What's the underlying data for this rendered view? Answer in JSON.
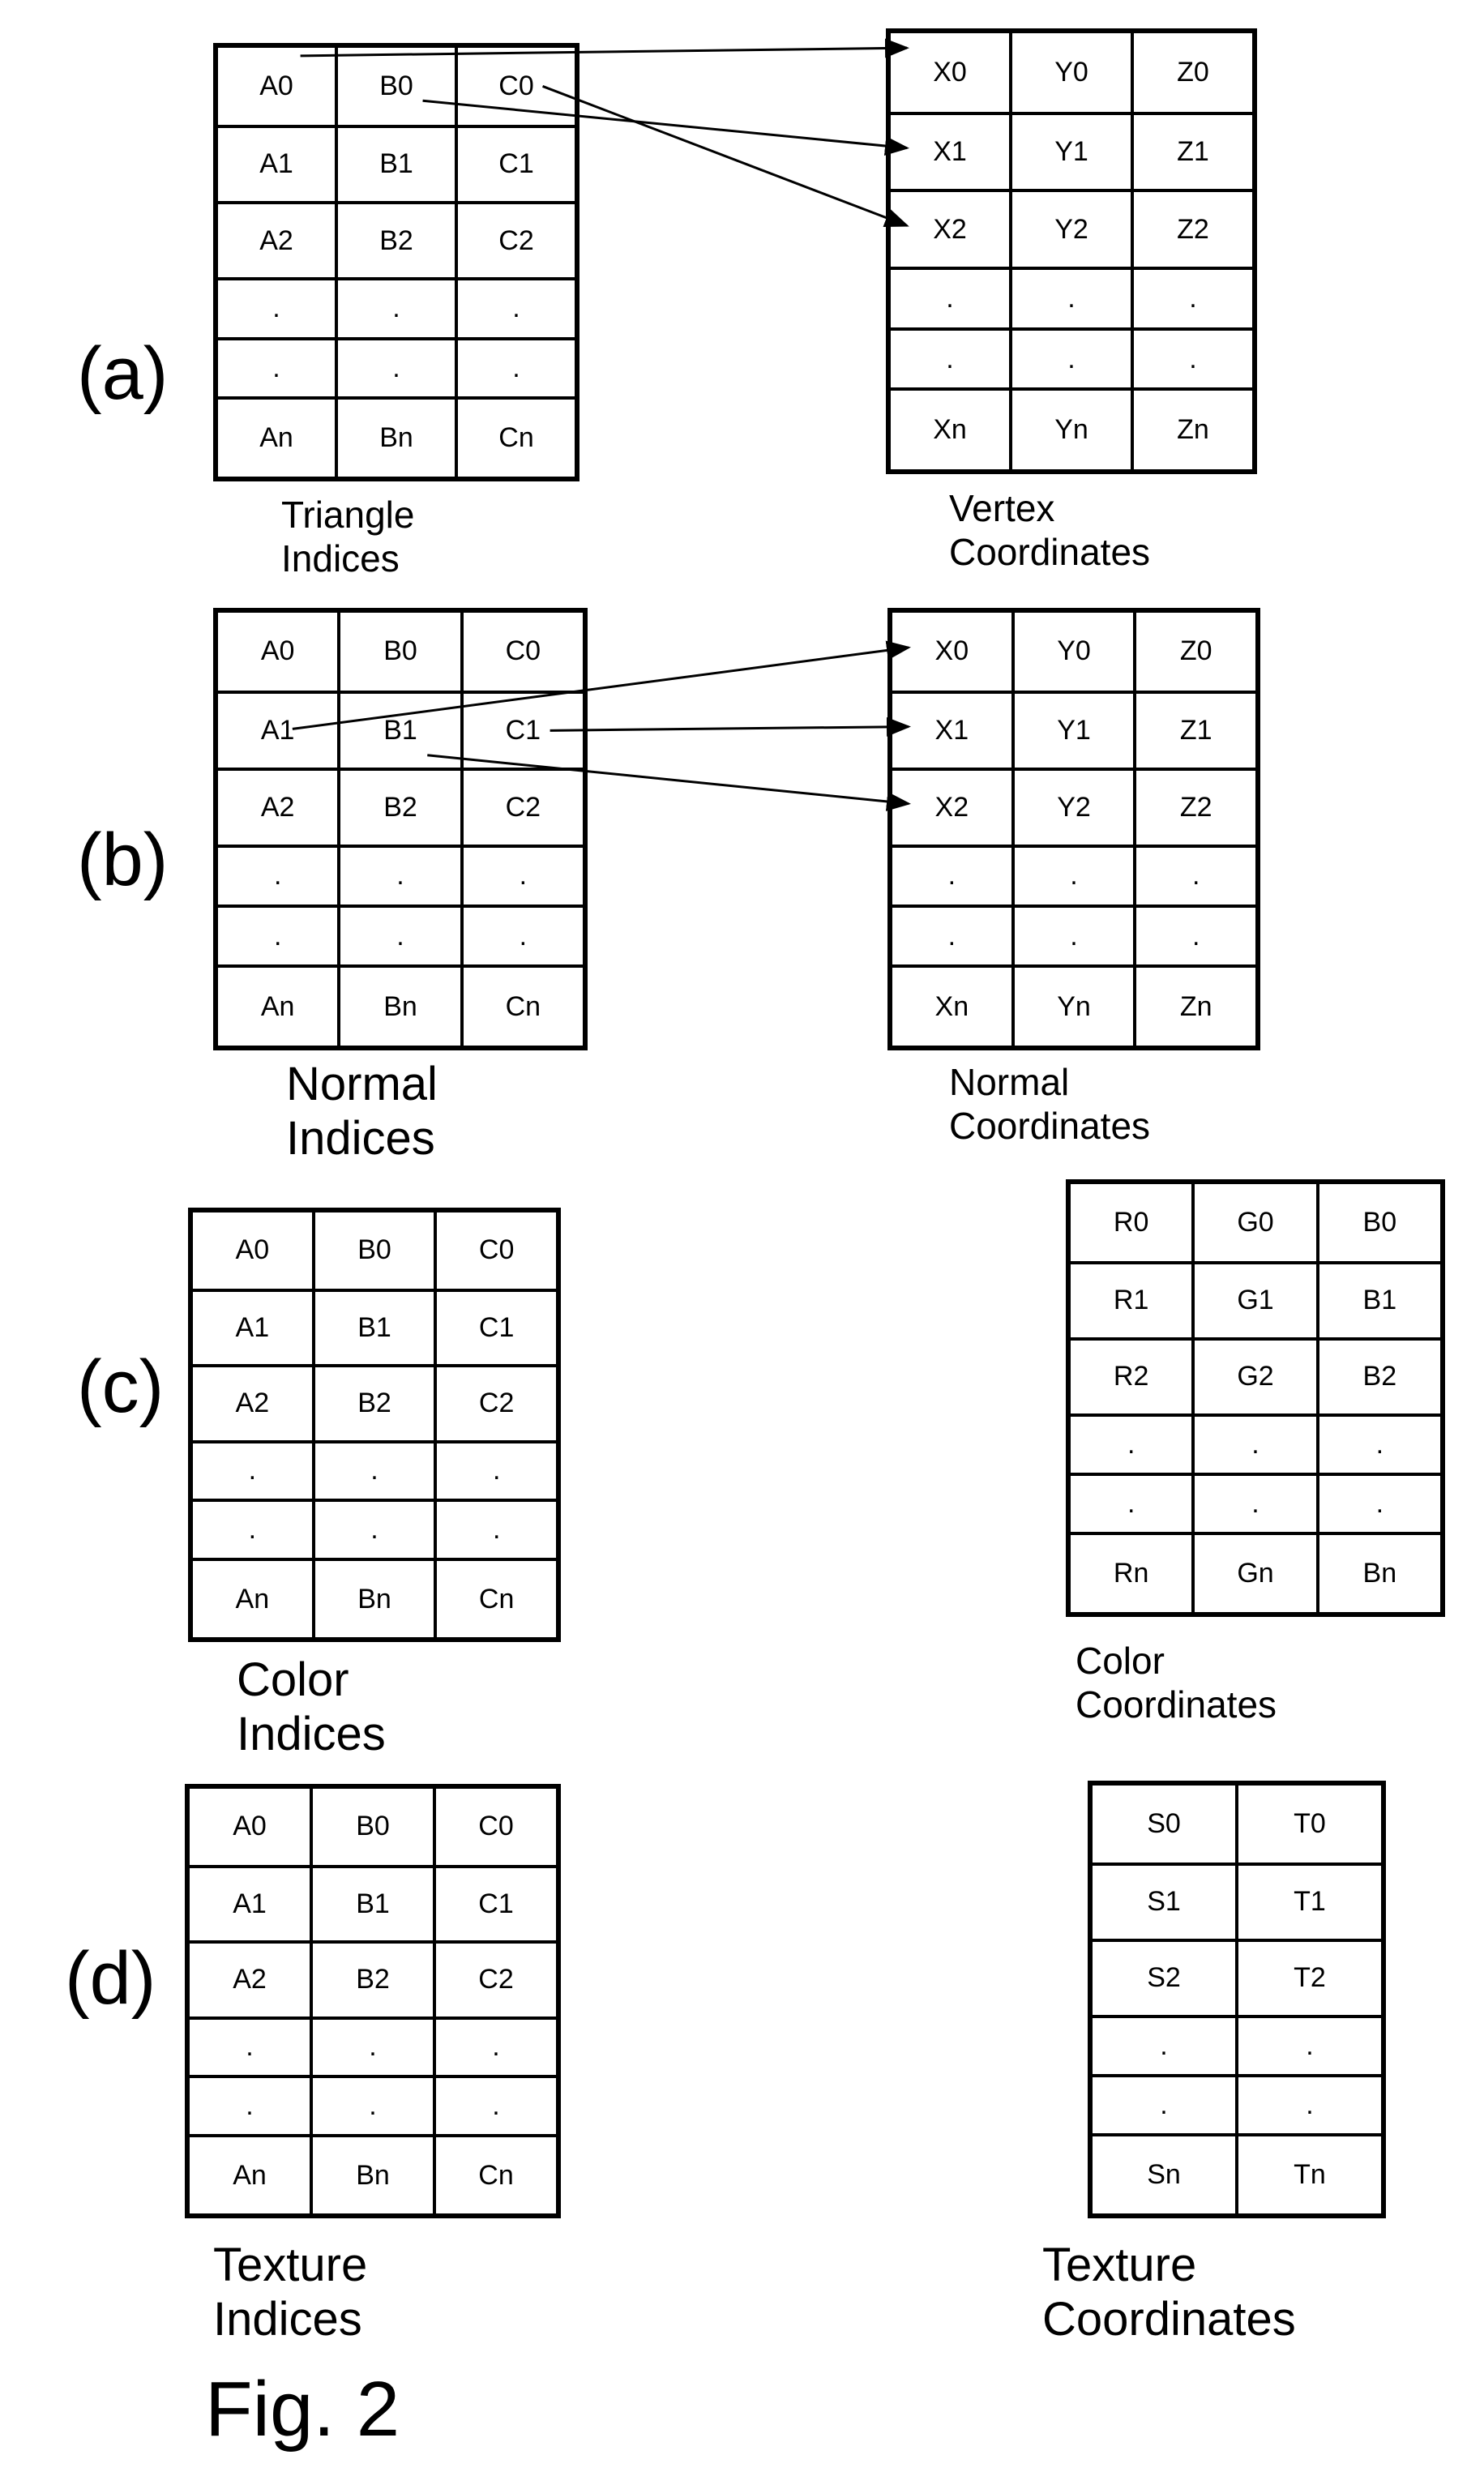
{
  "figure_title": "Fig. 2",
  "panels": [
    {
      "label": "(a)",
      "left": {
        "caption": "Triangle\nIndices",
        "rows": [
          [
            "A0",
            "B0",
            "C0"
          ],
          [
            "A1",
            "B1",
            "C1"
          ],
          [
            "A2",
            "B2",
            "C2"
          ],
          [
            ".",
            ".",
            "."
          ],
          [
            ".",
            ".",
            "."
          ],
          [
            "An",
            "Bn",
            "Cn"
          ]
        ]
      },
      "right": {
        "caption": "Vertex\nCoordinates",
        "rows": [
          [
            "X0",
            "Y0",
            "Z0"
          ],
          [
            "X1",
            "Y1",
            "Z1"
          ],
          [
            "X2",
            "Y2",
            "Z2"
          ],
          [
            ".",
            ".",
            "."
          ],
          [
            ".",
            ".",
            "."
          ],
          [
            "Xn",
            "Yn",
            "Zn"
          ]
        ]
      },
      "arrows": [
        {
          "from": "A0",
          "to": "X0"
        },
        {
          "from": "B0",
          "to": "X1"
        },
        {
          "from": "C0",
          "to": "X2"
        }
      ]
    },
    {
      "label": "(b)",
      "left": {
        "caption": "Normal\nIndices",
        "rows": [
          [
            "A0",
            "B0",
            "C0"
          ],
          [
            "A1",
            "B1",
            "C1"
          ],
          [
            "A2",
            "B2",
            "C2"
          ],
          [
            ".",
            ".",
            "."
          ],
          [
            ".",
            ".",
            "."
          ],
          [
            "An",
            "Bn",
            "Cn"
          ]
        ]
      },
      "right": {
        "caption": "Normal\nCoordinates",
        "rows": [
          [
            "X0",
            "Y0",
            "Z0"
          ],
          [
            "X1",
            "Y1",
            "Z1"
          ],
          [
            "X2",
            "Y2",
            "Z2"
          ],
          [
            ".",
            ".",
            "."
          ],
          [
            ".",
            ".",
            "."
          ],
          [
            "Xn",
            "Yn",
            "Zn"
          ]
        ]
      },
      "arrows": [
        {
          "from": "A1",
          "to": "X0"
        },
        {
          "from": "C1",
          "to": "X1"
        },
        {
          "from": "B1",
          "to": "X2"
        }
      ]
    },
    {
      "label": "(c)",
      "left": {
        "caption": "Color\nIndices",
        "rows": [
          [
            "A0",
            "B0",
            "C0"
          ],
          [
            "A1",
            "B1",
            "C1"
          ],
          [
            "A2",
            "B2",
            "C2"
          ],
          [
            ".",
            ".",
            "."
          ],
          [
            ".",
            ".",
            "."
          ],
          [
            "An",
            "Bn",
            "Cn"
          ]
        ]
      },
      "right": {
        "caption": "Color\nCoordinates",
        "rows": [
          [
            "R0",
            "G0",
            "B0"
          ],
          [
            "R1",
            "G1",
            "B1"
          ],
          [
            "R2",
            "G2",
            "B2"
          ],
          [
            ".",
            ".",
            "."
          ],
          [
            ".",
            ".",
            "."
          ],
          [
            "Rn",
            "Gn",
            "Bn"
          ]
        ]
      },
      "arrows": []
    },
    {
      "label": "(d)",
      "left": {
        "caption": "Texture\nIndices",
        "rows": [
          [
            "A0",
            "B0",
            "C0"
          ],
          [
            "A1",
            "B1",
            "C1"
          ],
          [
            "A2",
            "B2",
            "C2"
          ],
          [
            ".",
            ".",
            "."
          ],
          [
            ".",
            ".",
            "."
          ],
          [
            "An",
            "Bn",
            "Cn"
          ]
        ]
      },
      "right": {
        "caption": "Texture\nCoordinates",
        "rows": [
          [
            "S0",
            "T0"
          ],
          [
            "S1",
            "T1"
          ],
          [
            "S2",
            "T2"
          ],
          [
            ".",
            "."
          ],
          [
            ".",
            "."
          ],
          [
            "Sn",
            "Tn"
          ]
        ]
      },
      "arrows": []
    }
  ]
}
